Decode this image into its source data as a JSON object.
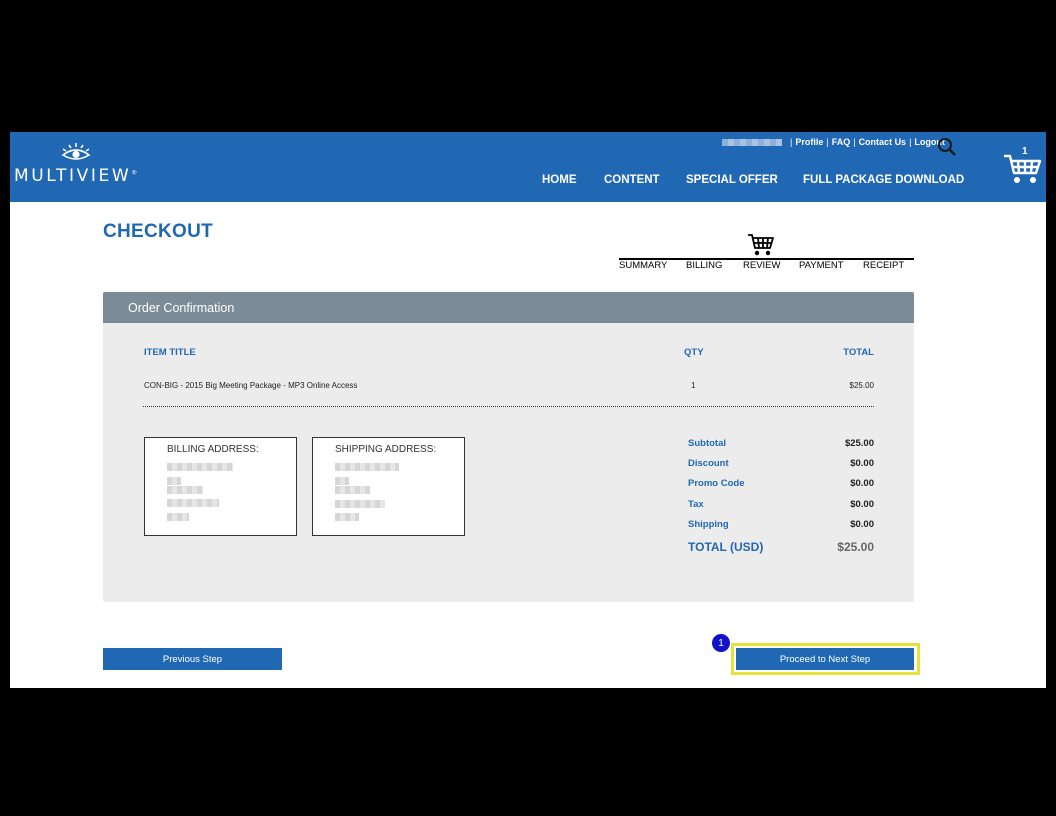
{
  "header": {
    "logo_text": "MULTIVIEW",
    "logo_mark": "®",
    "util_links": [
      "Profile",
      "FAQ",
      "Contact Us",
      "Logout"
    ],
    "cart_count": "1",
    "nav": [
      "HOME",
      "CONTENT",
      "SPECIAL OFFER",
      "FULL PACKAGE DOWNLOAD"
    ]
  },
  "page": {
    "title": "CHECKOUT",
    "steps": [
      "SUMMARY",
      "BILLING",
      "REVIEW",
      "PAYMENT",
      "RECEIPT"
    ]
  },
  "order": {
    "panel_title": "Order Confirmation",
    "columns": [
      "ITEM TITLE",
      "QTY",
      "TOTAL"
    ],
    "items": [
      {
        "title": "CON-BIG - 2015 Big Meeting Package - MP3 Online Access",
        "qty": "1",
        "total": "$25.00"
      }
    ],
    "billing_title": "BILLING ADDRESS:",
    "shipping_title": "SHIPPING ADDRESS:",
    "totals": [
      {
        "label": "Subtotal",
        "value": "$25.00"
      },
      {
        "label": "Discount",
        "value": "$0.00"
      },
      {
        "label": "Promo Code",
        "value": "$0.00"
      },
      {
        "label": "Tax",
        "value": "$0.00"
      },
      {
        "label": "Shipping",
        "value": "$0.00"
      }
    ],
    "grand_total_label": "TOTAL (USD)",
    "grand_total_value": "$25.00"
  },
  "buttons": {
    "previous": "Previous Step",
    "next": "Proceed to Next Step",
    "badge": "1"
  },
  "colors": {
    "brand_blue": "#2168b4",
    "panel_header": "#7c8b98",
    "panel_bg": "#ececec",
    "highlight": "#e6e23a",
    "badge": "#1212c8"
  },
  "icons": [
    "eye-logo-icon",
    "search-icon",
    "shopping-cart-icon"
  ]
}
